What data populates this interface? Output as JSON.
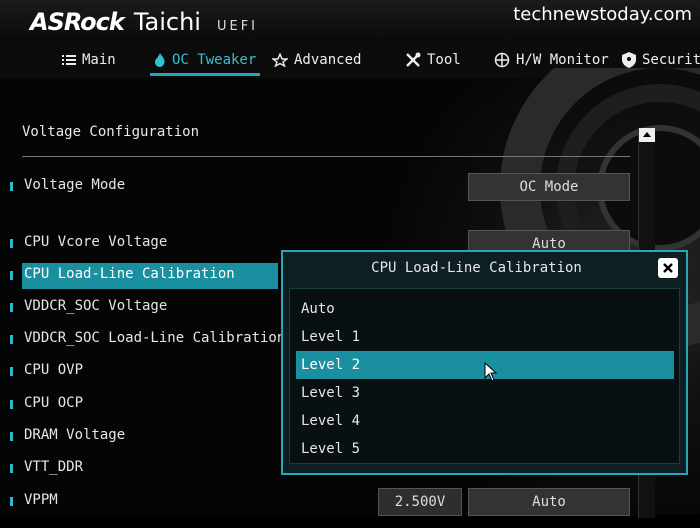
{
  "brand": {
    "name": "ASRock",
    "model": "Taichi",
    "suffix": "UEFI"
  },
  "watermark": "technewstoday.com",
  "tabs": [
    {
      "label": "Main",
      "icon": "list-icon"
    },
    {
      "label": "OC Tweaker",
      "icon": "flame-icon",
      "active": true
    },
    {
      "label": "Advanced",
      "icon": "star-icon"
    },
    {
      "label": "Tool",
      "icon": "tools-icon"
    },
    {
      "label": "H/W Monitor",
      "icon": "crosshair-icon"
    },
    {
      "label": "Security",
      "icon": "shield-icon"
    }
  ],
  "section_title": "Voltage Configuration",
  "settings": [
    {
      "label": "Voltage Mode",
      "value": "OC Mode"
    },
    {
      "label": "CPU Vcore Voltage",
      "value": "Auto"
    },
    {
      "label": "CPU Load-Line Calibration",
      "selected": true
    },
    {
      "label": "VDDCR_SOC Voltage"
    },
    {
      "label": "VDDCR_SOC Load-Line Calibration"
    },
    {
      "label": "CPU OVP"
    },
    {
      "label": "CPU OCP"
    },
    {
      "label": "DRAM Voltage"
    },
    {
      "label": "VTT_DDR"
    },
    {
      "label": "VPPM",
      "number": "2.500V",
      "value": "Auto"
    }
  ],
  "modal": {
    "title": "CPU Load-Line Calibration",
    "options": [
      "Auto",
      "Level 1",
      "Level 2",
      "Level 3",
      "Level 4",
      "Level 5"
    ],
    "selected_index": 2
  },
  "colors": {
    "accent": "#1a8fa0",
    "accent_light": "#33c2d4"
  }
}
